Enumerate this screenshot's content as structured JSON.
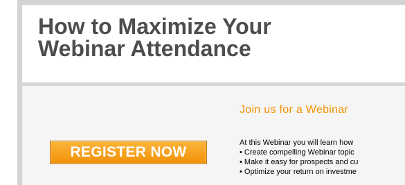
{
  "header": {
    "title_line1": "How to Maximize Your",
    "title_line2": "Webinar Attendance"
  },
  "main": {
    "register_button_label": "REGISTER NOW",
    "join_heading": "Join us for a Webinar",
    "intro_text": "At this Webinar you will learn how",
    "bullets": [
      "• Create compelling Webinar topic",
      "• Make it easy for prospects and cu",
      "• Optimize your return on investme"
    ]
  },
  "colors": {
    "title": "#4d4d4d",
    "accent_orange": "#f29100",
    "border_gray": "#d4d4d4",
    "content_background": "#f5f5f5"
  }
}
